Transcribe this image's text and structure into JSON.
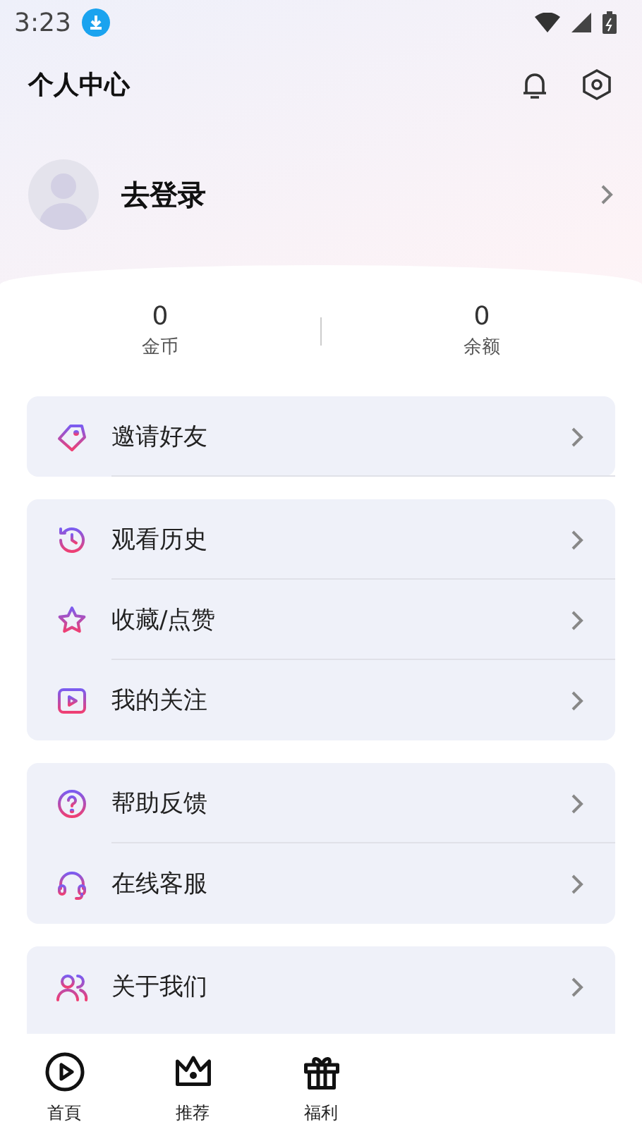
{
  "status_bar": {
    "time": "3:23"
  },
  "header": {
    "title": "个人中心"
  },
  "profile": {
    "name": "去登录"
  },
  "stats": [
    {
      "value": "0",
      "label": "金币"
    },
    {
      "value": "0",
      "label": "余额"
    }
  ],
  "menu_groups": [
    [
      {
        "label": "邀请好友"
      }
    ],
    [
      {
        "label": "观看历史"
      },
      {
        "label": "收藏/点赞"
      },
      {
        "label": "我的关注"
      }
    ],
    [
      {
        "label": "帮助反馈"
      },
      {
        "label": "在线客服"
      }
    ],
    [
      {
        "label": "关于我们"
      }
    ]
  ],
  "bottom_nav": [
    {
      "label": "首頁"
    },
    {
      "label": "推荐"
    },
    {
      "label": "福利"
    }
  ]
}
